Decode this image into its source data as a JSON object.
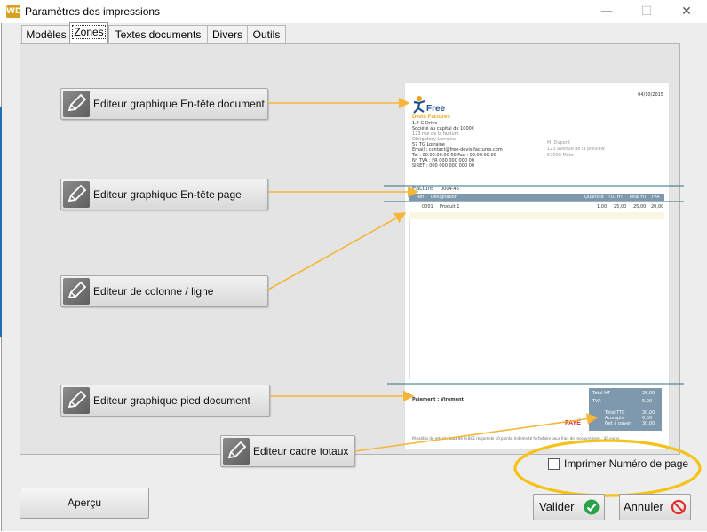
{
  "window": {
    "title": "Paramètres des impressions",
    "app_icon": "WD"
  },
  "tabs": [
    {
      "label": "Modèles",
      "active": false
    },
    {
      "label": "Zones",
      "active": true
    },
    {
      "label": "Textes documents",
      "active": false
    },
    {
      "label": "Divers",
      "active": false
    },
    {
      "label": "Outils",
      "active": false
    }
  ],
  "zones": {
    "en_tete_document": "Editeur graphique En-tête document",
    "en_tete_page": "Editeur graphique En-tête page",
    "colonne_ligne": "Editeur de colonne / ligne",
    "pied_document": "Editeur graphique pied document",
    "cadre_totaux": "Editeur cadre totaux"
  },
  "preview": {
    "date": "04/10/2015",
    "logo_word": "Free",
    "logo_sub": "Devis Factures",
    "company_lines": [
      "1,4 G Drive",
      "Société au capital de 1000€",
      "123 rue de la facture",
      "Obrigatory Lorraine",
      "57 TG Lorraine",
      "Email : contact@free-devis-factures.com",
      "Tel : 00.00.00.00 00 Fax : 00.00.00.00",
      "N° TVA : FR 000 000 000 00",
      "SIRET : 000 000 000 000 00"
    ],
    "client_lines": [
      "M. Dupont",
      "123 avenue de la preview",
      "57000 Metz"
    ],
    "facture_label": "Facture",
    "facture_number": "0004-45",
    "columns": [
      "Réf",
      "Désignation",
      "Quantité",
      "P.U. HT",
      "Total HT",
      "TVA"
    ],
    "row": [
      "0001",
      "Produit 1",
      "1,00",
      "25,00",
      "25,00",
      "20,00"
    ],
    "paiement": "Paiement : Virement",
    "paye_stamp": "PAYÉ",
    "totals_lines": [
      "Total HT",
      "TVA",
      "Total TTC",
      "Acompte",
      "Net à payer"
    ],
    "totals_values": [
      "25,00",
      "5,00",
      "30,00",
      "0,00",
      "30,00"
    ],
    "footer_text": "Pénalités de retard : taux de la BCE majoré de 10 points. Indemnité forfaitaire pour frais de recouvrement : 40 euros"
  },
  "options": {
    "print_page_number_label": "Imprimer Numéro de page",
    "print_page_number_checked": false
  },
  "buttons": {
    "apercu": "Aperçu",
    "valider": "Valider",
    "annuler": "Annuler"
  },
  "colors": {
    "accent_orange": "#f5b63a",
    "ok_green": "#2aa24a",
    "cancel_red": "#e03131",
    "preview_band": "#7e98ad"
  }
}
